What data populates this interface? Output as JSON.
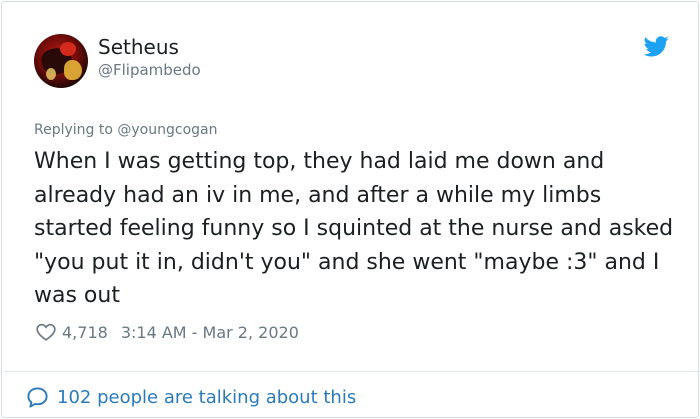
{
  "tweet": {
    "author": {
      "name": "Setheus",
      "handle": "@Flipambedo"
    },
    "replying_prefix": "Replying to ",
    "replying_to": "@youngcogan",
    "text": "When I was getting top, they had laid me down and already had an iv in me, and after a while my limbs started feeling funny so I squinted at the nurse and asked \"you put it in, didn't you\" and she went \"maybe :3\" and I was out",
    "likes": "4,718",
    "timestamp": "3:14 AM - Mar 2, 2020",
    "conversation": "102 people are talking about this"
  },
  "icons": {
    "brand": "twitter-bird-icon",
    "like": "heart-icon",
    "conversation": "speech-bubble-icon"
  },
  "colors": {
    "brand_blue": "#1da1f2",
    "link_blue": "#2b7bb9",
    "text": "#1c2022",
    "muted": "#697882",
    "border": "#d8dfe4"
  }
}
